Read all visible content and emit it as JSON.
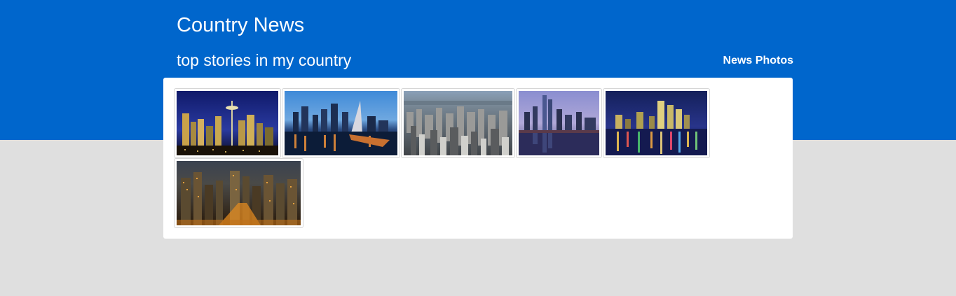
{
  "header": {
    "title": "Country News",
    "subtitle": "top stories in my country",
    "nav_link": "News Photos"
  },
  "colors": {
    "header_blue": "#0066cc",
    "page_background": "#dfdfdf",
    "panel_background": "#ffffff"
  },
  "gallery": {
    "photos": [
      {
        "subject": "night-city-skyline-with-space-needle"
      },
      {
        "subject": "waterfront-skyline-at-dusk-with-bridge"
      },
      {
        "subject": "aerial-view-of-dense-city"
      },
      {
        "subject": "skyline-reflected-in-water-at-twilight"
      },
      {
        "subject": "night-skyline-with-colorful-water-reflections"
      },
      {
        "subject": "downtown-skyline-at-night-warm-lights"
      }
    ]
  }
}
